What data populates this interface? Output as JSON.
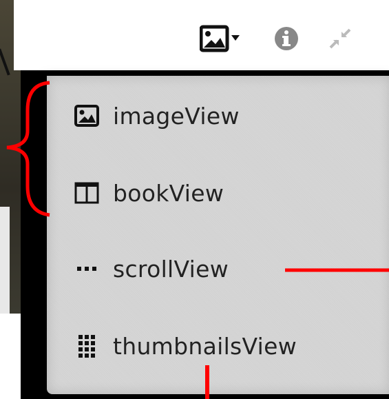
{
  "toolbar": {
    "icons": [
      "image-icon",
      "dropdown-caret-icon",
      "info-icon",
      "collapse-icon"
    ]
  },
  "menu": {
    "items": [
      {
        "label": "imageView",
        "icon": "image-icon"
      },
      {
        "label": "bookView",
        "icon": "book-icon"
      },
      {
        "label": "scrollView",
        "icon": "dots-icon"
      },
      {
        "label": "thumbnailsView",
        "icon": "grid-icon"
      }
    ]
  },
  "colors": {
    "annotation": "#ff0000",
    "menu_background": "#d4d4d4",
    "frame": "#000000",
    "text": "#222222"
  }
}
